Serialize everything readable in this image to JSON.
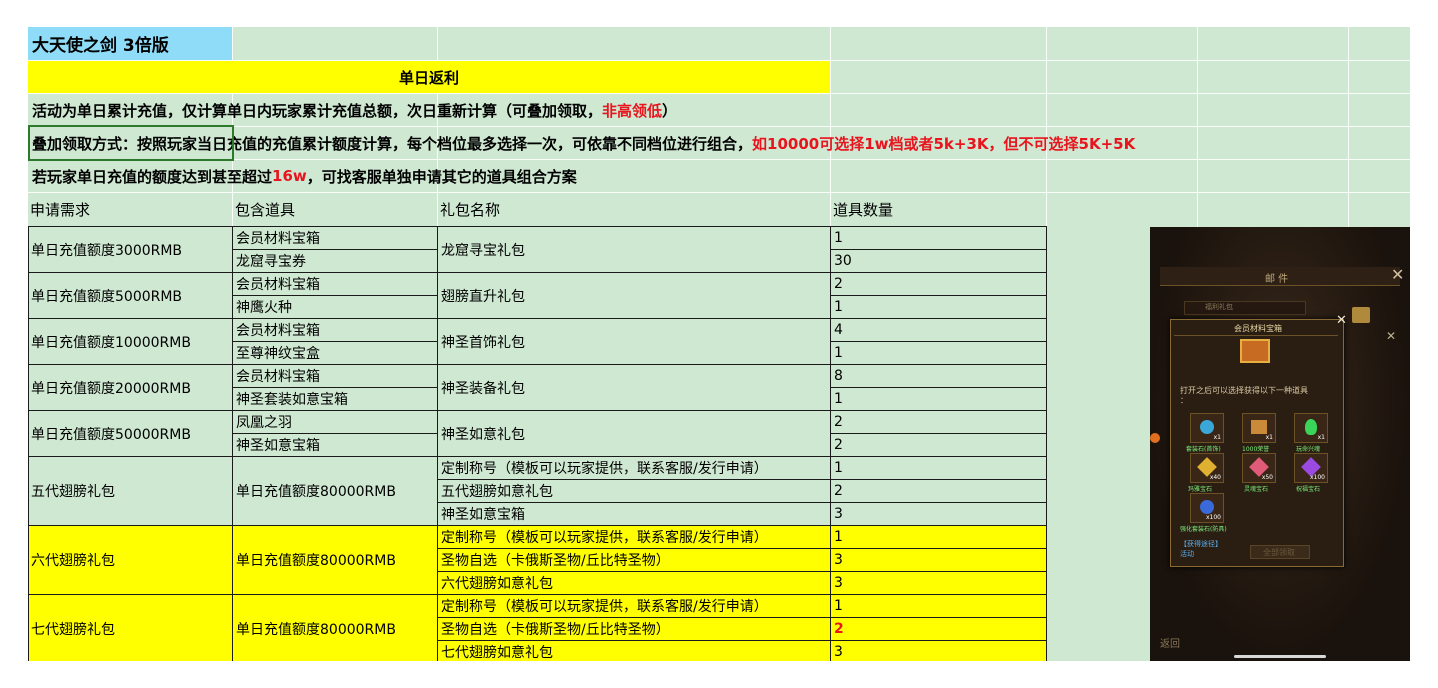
{
  "title": "大天使之剑 3倍版",
  "subtitle": "单日返利",
  "rules": {
    "line1_black": "活动为单日累计充值，仅计算单日内玩家累计充值总额，次日重新计算（可叠加领取，",
    "line1_red": "非高领低",
    "line1_end": "）",
    "line2_black": "叠加领取方式：按照玩家当日充值的充值累计额度计算，每个档位最多选择一次，可依靠不同档位进行组合，",
    "line2_red": "如10000可选择1w档或者5k+3K，但不可选择5K+5K",
    "line3_black": "若玩家单日充值的额度达到甚至超过",
    "line3_red": "16w",
    "line3_end": "，可找客服单独申请其它的道具组合方案"
  },
  "headers": [
    "申请需求",
    "包含道具",
    "礼包名称",
    "道具数量"
  ],
  "tiers": [
    {
      "requirement": "单日充值额度3000RMB",
      "package": "龙窟寻宝礼包",
      "items": [
        "会员材料宝箱",
        "龙窟寻宝券"
      ],
      "qty": [
        "1",
        "30"
      ]
    },
    {
      "requirement": "单日充值额度5000RMB",
      "package": "翅膀直升礼包",
      "items": [
        "会员材料宝箱",
        "神鹰火种"
      ],
      "qty": [
        "2",
        "1"
      ]
    },
    {
      "requirement": "单日充值额度10000RMB",
      "package": "神圣首饰礼包",
      "items": [
        "会员材料宝箱",
        "至尊神纹宝盒"
      ],
      "qty": [
        "4",
        "1"
      ]
    },
    {
      "requirement": "单日充值额度20000RMB",
      "package": "神圣装备礼包",
      "items": [
        "会员材料宝箱",
        "神圣套装如意宝箱"
      ],
      "qty": [
        "8",
        "1"
      ]
    },
    {
      "requirement": "单日充值额度50000RMB",
      "package": "神圣如意礼包",
      "items": [
        "凤凰之羽",
        "神圣如意宝箱"
      ],
      "qty": [
        "2",
        "2"
      ]
    }
  ],
  "wing_tiers": [
    {
      "name": "五代翅膀礼包",
      "requirement": "单日充值额度80000RMB",
      "highlight": false,
      "rows": [
        {
          "item": "定制称号（模板可以玩家提供，联系客服/发行申请）",
          "qty": "1"
        },
        {
          "item": "五代翅膀如意礼包",
          "qty": "2"
        },
        {
          "item": "神圣如意宝箱",
          "qty": "3"
        }
      ]
    },
    {
      "name": "六代翅膀礼包",
      "requirement": "单日充值额度80000RMB",
      "highlight": true,
      "rows": [
        {
          "item": "定制称号（模板可以玩家提供，联系客服/发行申请）",
          "qty": "1"
        },
        {
          "item": "圣物自选（卡俄斯圣物/丘比特圣物）",
          "qty": "3"
        },
        {
          "item": "六代翅膀如意礼包",
          "qty": "3"
        }
      ]
    },
    {
      "name": "七代翅膀礼包",
      "requirement": "单日充值额度80000RMB",
      "highlight": true,
      "rows": [
        {
          "item": "定制称号（模板可以玩家提供，联系客服/发行申请）",
          "qty": "1"
        },
        {
          "item": "圣物自选（卡俄斯圣物/丘比特圣物）",
          "qty": "2",
          "qty_red": true
        },
        {
          "item": "七代翅膀如意礼包",
          "qty": "3"
        }
      ]
    }
  ],
  "game_popup": {
    "mail_title": "邮 件",
    "box_title": "会员材料宝箱",
    "desc": "打开之后可以选择获得以下一种道具",
    "desc2": "：",
    "search_hint": "福利礼包",
    "items": [
      {
        "label": "套装石(首饰)",
        "count": "x1",
        "color": "#3aa7d9"
      },
      {
        "label": "1000荣誉",
        "count": "x1",
        "color": "#c98a3a"
      },
      {
        "label": "玩命兴魂",
        "count": "x1",
        "color": "#3ad45a"
      },
      {
        "label": "玛雅宝石",
        "count": "x40",
        "color": "#e0b030"
      },
      {
        "label": "灵魂宝石",
        "count": "x50",
        "color": "#e05a7a"
      },
      {
        "label": "祝福宝石",
        "count": "x100",
        "color": "#9a4ae0"
      },
      {
        "label": "强化套装石(防具)",
        "count": "x100",
        "color": "#3a6ad9"
      }
    ],
    "source_title": "【获得途径】",
    "source": "活动",
    "confirm": "全部领取",
    "back": "返回",
    "colors": {
      "panel": "#2a1d12",
      "frame": "#8a6a34",
      "title": "#e8d8a8"
    }
  },
  "colors": {
    "sheet_bg": "#cfe8d2",
    "title_bg": "#8fdcf8",
    "highlight": "#ffff00",
    "red": "#e8141e"
  }
}
